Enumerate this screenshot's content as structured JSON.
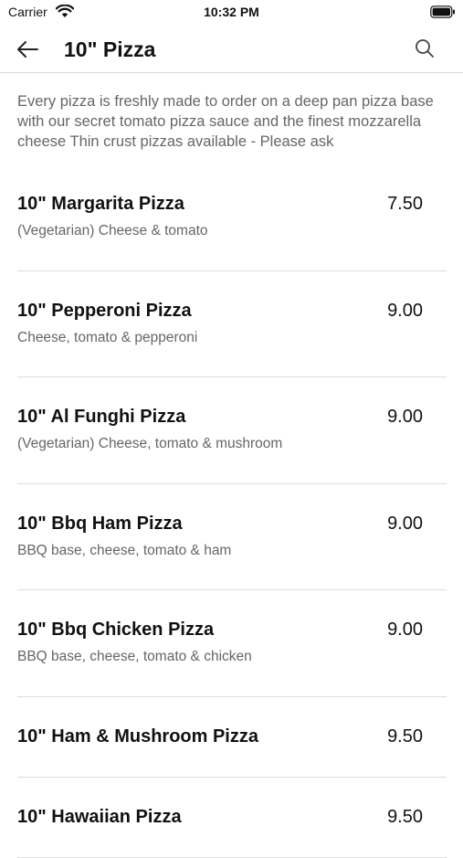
{
  "status_bar": {
    "carrier": "Carrier",
    "time": "10:32 PM",
    "wifi_icon": "wifi-icon",
    "battery_icon": "battery-icon"
  },
  "header": {
    "back_icon": "arrow-left-icon",
    "title": "10\" Pizza",
    "search_icon": "search-icon"
  },
  "intro": "Every pizza is freshly made to order on a deep pan pizza base with our secret tomato pizza sauce and the finest mozzarella cheese Thin crust pizzas available - Please ask",
  "items": [
    {
      "name": "10\" Margarita Pizza",
      "price": "7.50",
      "description": "(Vegetarian) Cheese & tomato"
    },
    {
      "name": "10\" Pepperoni Pizza",
      "price": "9.00",
      "description": "Cheese, tomato & pepperoni"
    },
    {
      "name": "10\" Al Funghi Pizza",
      "price": "9.00",
      "description": "(Vegetarian) Cheese, tomato & mushroom"
    },
    {
      "name": "10\" Bbq Ham Pizza",
      "price": "9.00",
      "description": "BBQ base, cheese, tomato & ham"
    },
    {
      "name": "10\" Bbq Chicken Pizza",
      "price": "9.00",
      "description": "BBQ base, cheese, tomato & chicken"
    },
    {
      "name": "10\" Ham & Mushroom Pizza",
      "price": "9.50",
      "description": ""
    },
    {
      "name": "10\" Hawaiian Pizza",
      "price": "9.50",
      "description": ""
    }
  ],
  "colors": {
    "text_primary": "#111111",
    "text_secondary": "#666666",
    "divider": "#dddddd",
    "background": "#ffffff"
  }
}
